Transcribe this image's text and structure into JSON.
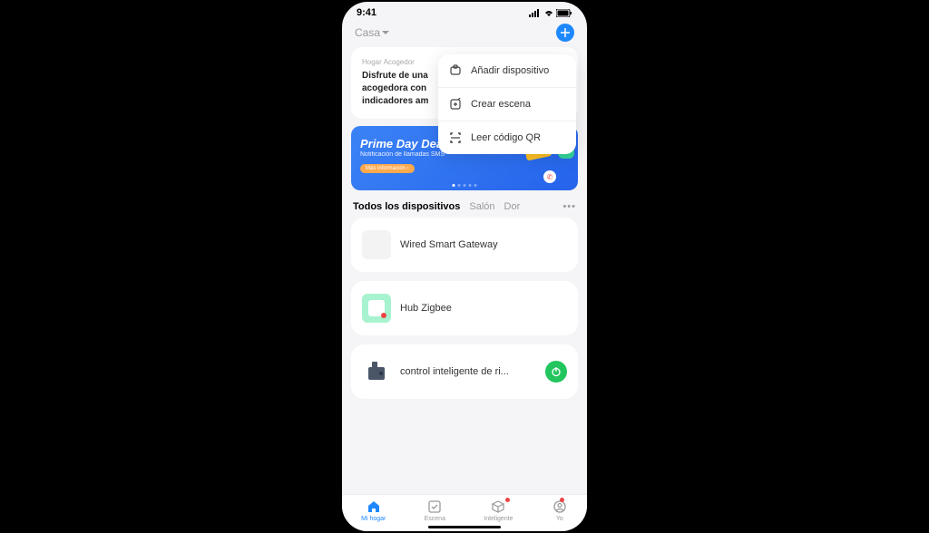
{
  "statusBar": {
    "time": "9:41"
  },
  "header": {
    "homeLabel": "Casa"
  },
  "dropdown": {
    "items": [
      {
        "label": "Añadir dispositivo"
      },
      {
        "label": "Crear escena"
      },
      {
        "label": "Leer código QR"
      }
    ]
  },
  "welcomeCard": {
    "sub": "Hogar Acogedor",
    "text": "Disfrute de una acogedora con indicadores am"
  },
  "promo": {
    "title": "Prime Day Deals",
    "sub": "Notificación de llamadas SMS",
    "cta": "Más información ›"
  },
  "tabs": {
    "all": "Todos los dispositivos",
    "room1": "Salón",
    "room2": "Dor"
  },
  "devices": [
    {
      "name": "Wired Smart Gateway"
    },
    {
      "name": "Hub Zigbee"
    },
    {
      "name": "control inteligente de ri..."
    }
  ],
  "tabBar": {
    "home": "Mi hogar",
    "scene": "Escena",
    "smart": "Inteligente",
    "me": "Yo"
  }
}
